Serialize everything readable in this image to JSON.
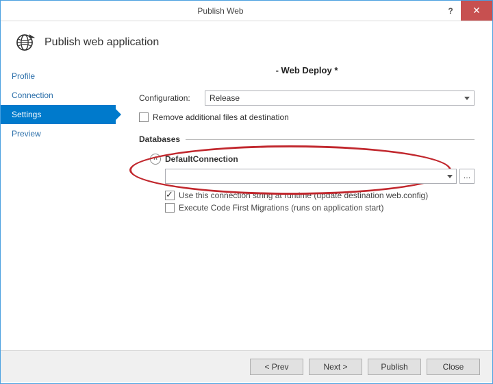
{
  "window": {
    "title": "Publish Web"
  },
  "header": {
    "heading": "Publish web application"
  },
  "sidebar": {
    "items": [
      {
        "label": "Profile",
        "selected": false
      },
      {
        "label": "Connection",
        "selected": false
      },
      {
        "label": "Settings",
        "selected": true
      },
      {
        "label": "Preview",
        "selected": false
      }
    ]
  },
  "main": {
    "deploy_title": "- Web Deploy *",
    "config_label": "Configuration:",
    "config_value": "Release",
    "remove_files_label": "Remove additional files at destination",
    "databases_heading": "Databases",
    "db": {
      "name": "DefaultConnection",
      "conn_value": "",
      "use_runtime_label": "Use this connection string at runtime (update destination web.config)",
      "migrations_label": "Execute Code First Migrations (runs on application start)"
    }
  },
  "footer": {
    "prev": "< Prev",
    "next": "Next >",
    "publish": "Publish",
    "close": "Close"
  }
}
